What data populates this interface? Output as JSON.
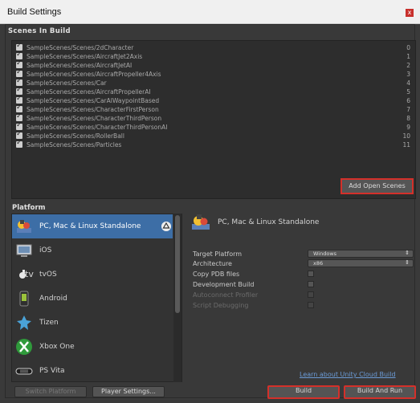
{
  "window": {
    "title": "Build Settings",
    "close_glyph": "x"
  },
  "scenes": {
    "header": "Scenes In Build",
    "items": [
      {
        "path": "SampleScenes/Scenes/2dCharacter",
        "index": "0"
      },
      {
        "path": "SampleScenes/Scenes/AircraftJet2Axis",
        "index": "1"
      },
      {
        "path": "SampleScenes/Scenes/AircraftJetAI",
        "index": "2"
      },
      {
        "path": "SampleScenes/Scenes/AircraftPropeller4Axis",
        "index": "3"
      },
      {
        "path": "SampleScenes/Scenes/Car",
        "index": "4"
      },
      {
        "path": "SampleScenes/Scenes/AircraftPropellerAI",
        "index": "5"
      },
      {
        "path": "SampleScenes/Scenes/CarAIWaypointBased",
        "index": "6"
      },
      {
        "path": "SampleScenes/Scenes/CharacterFirstPerson",
        "index": "7"
      },
      {
        "path": "SampleScenes/Scenes/CharacterThirdPerson",
        "index": "8"
      },
      {
        "path": "SampleScenes/Scenes/CharacterThirdPersonAI",
        "index": "9"
      },
      {
        "path": "SampleScenes/Scenes/RollerBall",
        "index": "10"
      },
      {
        "path": "SampleScenes/Scenes/Particles",
        "index": "11"
      }
    ],
    "add_open_label": "Add Open Scenes"
  },
  "platform": {
    "header": "Platform",
    "items": [
      {
        "label": "PC, Mac & Linux Standalone",
        "icon": "unity-standalone-icon",
        "selected": true
      },
      {
        "label": "iOS",
        "icon": "ios-icon"
      },
      {
        "label": "tvOS",
        "icon": "appletv-icon"
      },
      {
        "label": "Android",
        "icon": "android-icon"
      },
      {
        "label": "Tizen",
        "icon": "tizen-icon"
      },
      {
        "label": "Xbox One",
        "icon": "xbox-icon"
      },
      {
        "label": "PS Vita",
        "icon": "psvita-icon"
      }
    ],
    "tv_glyph": "tv"
  },
  "settings": {
    "title": "PC, Mac & Linux Standalone",
    "target_platform_label": "Target Platform",
    "target_platform_value": "Windows",
    "architecture_label": "Architecture",
    "architecture_value": "x86",
    "copy_pdb_label": "Copy PDB files",
    "development_build_label": "Development Build",
    "autoconnect_label": "Autoconnect Profiler",
    "script_debugging_label": "Script Debugging"
  },
  "footer": {
    "cloud_link": "Learn about Unity Cloud Build",
    "switch_platform": "Switch Platform",
    "player_settings": "Player Settings...",
    "build": "Build",
    "build_and_run": "Build And Run"
  },
  "colors": {
    "highlight": "#d4302a",
    "selection": "#3d6ea6"
  }
}
